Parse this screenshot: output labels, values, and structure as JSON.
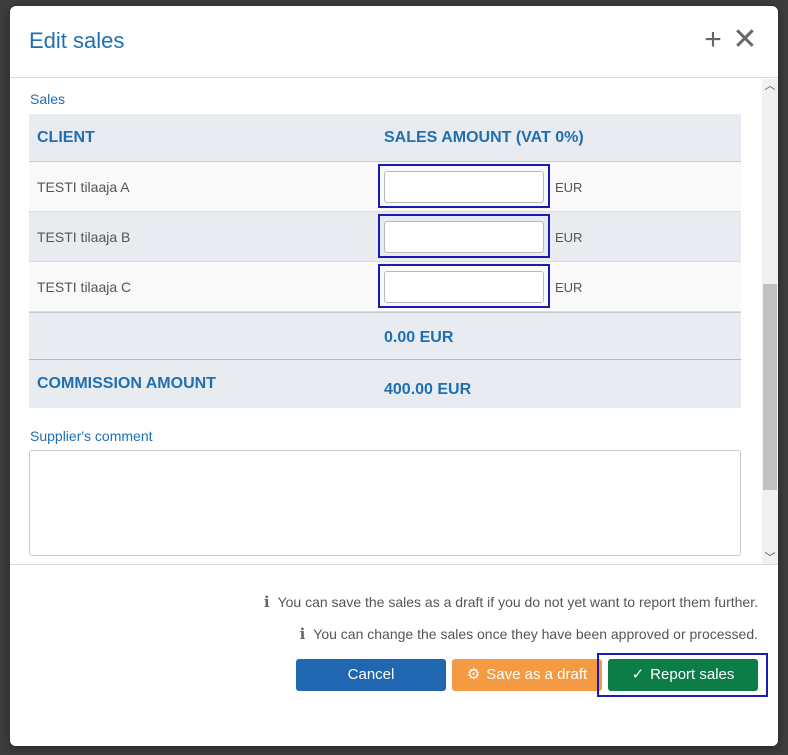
{
  "dialog": {
    "title": "Edit sales",
    "add_icon": "plus-icon",
    "close_icon": "close-icon"
  },
  "sales": {
    "section_label": "Sales",
    "columns": {
      "client": "CLIENT",
      "amount": "SALES AMOUNT (VAT 0%)"
    },
    "rows": [
      {
        "client": "TESTI tilaaja A",
        "amount": "",
        "currency": "EUR"
      },
      {
        "client": "TESTI tilaaja B",
        "amount": "",
        "currency": "EUR"
      },
      {
        "client": "TESTI tilaaja C",
        "amount": "",
        "currency": "EUR"
      }
    ],
    "total": "0.00 EUR",
    "commission_label": "COMMISSION AMOUNT",
    "commission_value": "400.00 EUR"
  },
  "comment": {
    "label": "Supplier's comment",
    "value": ""
  },
  "footer": {
    "info": [
      "You can save the sales as a draft if you do not yet want to report them further.",
      "You can change the sales once they have been approved or processed."
    ],
    "cancel_label": "Cancel",
    "draft_label": "Save as a draft",
    "report_label": "Report sales"
  },
  "colors": {
    "accent": "#1f6fb2",
    "cancel": "#1f67b0",
    "draft": "#f39a42",
    "report": "#0d7d48"
  }
}
